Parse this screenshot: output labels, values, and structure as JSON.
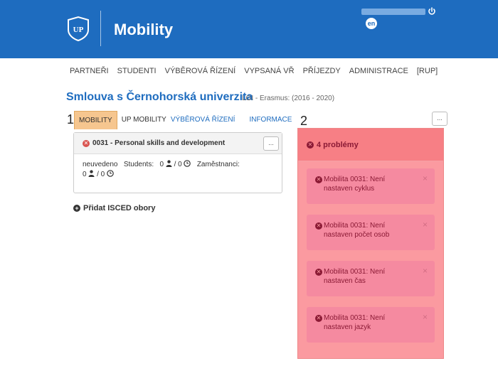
{
  "header": {
    "app_title": "Mobility",
    "lang": "en",
    "icons": {
      "logo": "university-logo-icon",
      "logout": "power-icon"
    }
  },
  "nav": {
    "items": [
      "PARTNEŘI",
      "STUDENTI",
      "VÝBĚROVÁ ŘÍZENÍ",
      "VYPSANÁ VŘ",
      "PŘÍJEZDY",
      "ADMINISTRACE",
      "[RUP]"
    ]
  },
  "page": {
    "title": "Smlouva s Černohorská univerzita",
    "subtitle": "LGI - Erasmus: (2016 - 2020)"
  },
  "steps": {
    "left": "1",
    "right": "2"
  },
  "tabs": [
    "MOBILITY",
    "UP MOBILITY",
    "VÝBĚROVÁ ŘÍZENÍ",
    "INFORMACE"
  ],
  "mobility_card": {
    "title": "0031 - Personal skills and development",
    "menu_label": "...",
    "status": "neuvedeno",
    "students_label": "Students:",
    "students_value": "0",
    "students_sep": "/ 0",
    "staff_label": "Zaměstnanci:",
    "staff_value": "0",
    "staff_sep": "/ 0"
  },
  "add_isced_label": "Přidat ISCED obory",
  "panel_menu_label": "...",
  "problems": {
    "title": "4 problémy",
    "items": [
      {
        "text": "Mobilita 0031: Není nastaven cyklus"
      },
      {
        "text": "Mobilita 0031: Není nastaven počet osob"
      },
      {
        "text": "Mobilita 0031: Není nastaven čas"
      },
      {
        "text": "Mobilita 0031: Není nastaven jazyk"
      }
    ],
    "close_symbol": "×"
  },
  "colors": {
    "header_bg": "#1e6cbf",
    "title_blue": "#1e6cbf",
    "active_tab": "#f6c68f",
    "problems_bg": "#fb9aa0",
    "alert_bg": "#f58aa0",
    "alert_text": "#8b1a35"
  }
}
